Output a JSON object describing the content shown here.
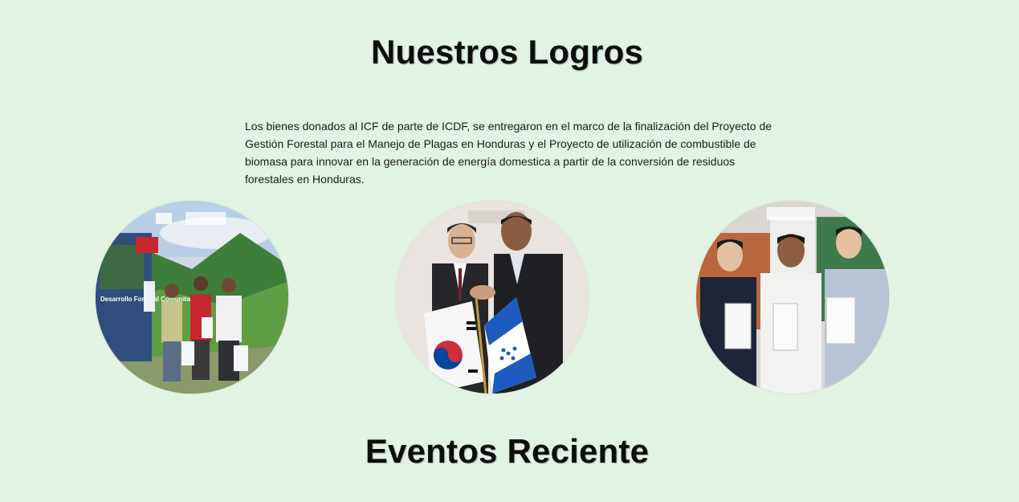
{
  "logros": {
    "title": "Nuestros Logros",
    "description": "Los bienes donados al ICF de parte de ICDF, se entregaron en el marco de la finalización del Proyecto de Gestión Forestal para el Manejo de Plagas en Honduras y el Proyecto de utilización de combustible de biomasa para innovar en la generación de energía domestica a partir de la conversión de residuos forestales en Honduras.",
    "photos": [
      {
        "icon": "photo-forest-donation",
        "banner_text": "Desarrollo Forestal Comunitario"
      },
      {
        "icon": "photo-handshake-flags"
      },
      {
        "icon": "photo-signing-agreement"
      }
    ]
  },
  "eventos": {
    "title": "Eventos Reciente"
  },
  "colors": {
    "background": "#e3f3e3",
    "heading": "#0d0d0d",
    "text": "#1a1a1a"
  }
}
